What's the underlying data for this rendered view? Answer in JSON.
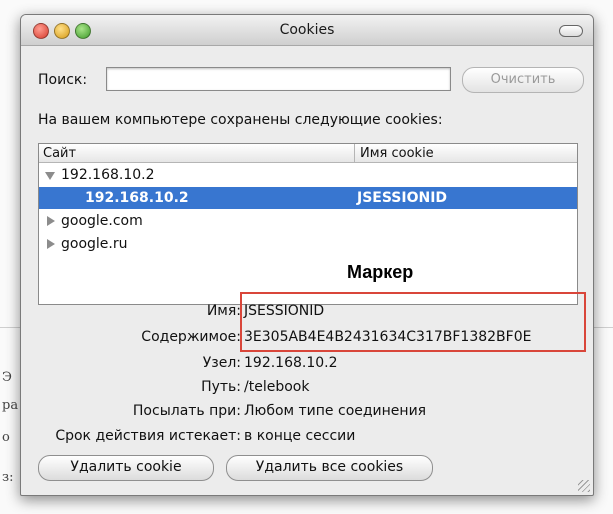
{
  "window": {
    "title": "Cookies"
  },
  "search": {
    "label": "Поиск:",
    "value": "",
    "placeholder": "",
    "clear_label": "Очистить"
  },
  "saved_text": "На вашем компьютере сохранены следующие cookies:",
  "table": {
    "columns": [
      "Сайт",
      "Имя cookie"
    ],
    "rows": [
      {
        "site": "192.168.10.2",
        "cookie_name": "",
        "disclosure": "expanded",
        "selected": false
      },
      {
        "site": "192.168.10.2",
        "cookie_name": "JSESSIONID",
        "disclosure": "none",
        "selected": true
      },
      {
        "site": "google.com",
        "cookie_name": "",
        "disclosure": "collapsed",
        "selected": false
      },
      {
        "site": "google.ru",
        "cookie_name": "",
        "disclosure": "collapsed",
        "selected": false
      }
    ]
  },
  "annotation": {
    "marker_label": "Маркер",
    "highlight_color": "#d9463a"
  },
  "details": {
    "name_label": "Имя:",
    "name_value": "JSESSIONID",
    "content_label": "Содержимое:",
    "content_value": "3E305AB4E4B2431634C317BF1382BF0E",
    "host_label": "Узел:",
    "host_value": "192.168.10.2",
    "path_label": "Путь:",
    "path_value": "/telebook",
    "send_label": "Посылать при:",
    "send_value": "Любом типе соединения",
    "expires_label": "Срок действия истекает:",
    "expires_value": "в конце сессии"
  },
  "buttons": {
    "delete_cookie": "Удалить cookie",
    "delete_all": "Удалить все cookies"
  },
  "background_text": {
    "fragment_1": "Э",
    "fragment_2": "ра",
    "fragment_3": "о",
    "fragment_4": "з:"
  },
  "colors": {
    "selection": "#3876d0",
    "window_bg": "#ececec"
  }
}
